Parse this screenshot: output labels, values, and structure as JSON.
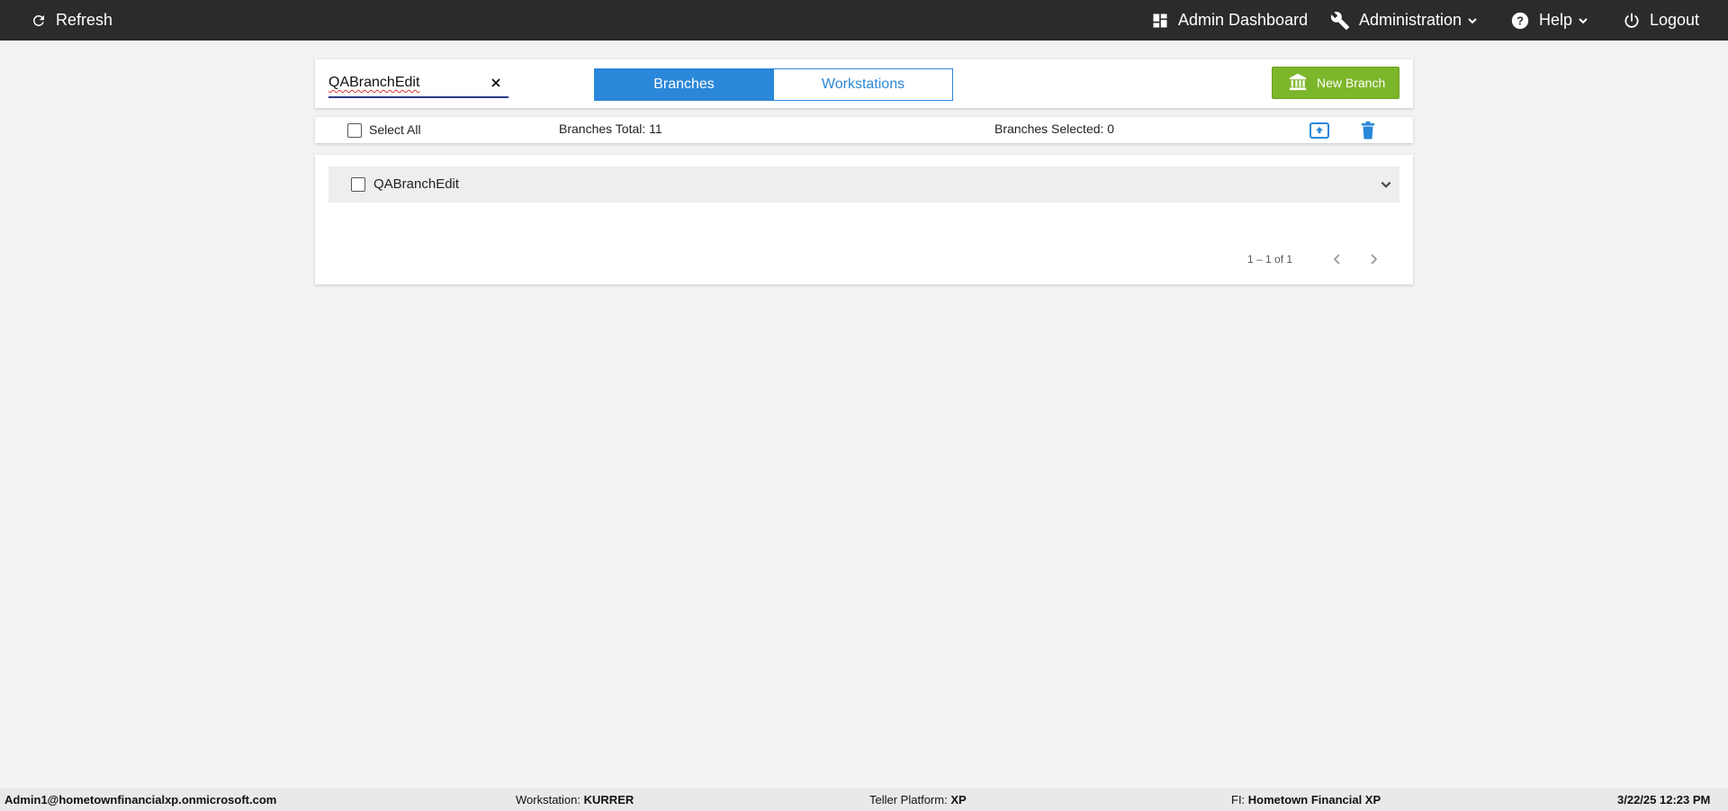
{
  "nav": {
    "refresh_label": "Refresh",
    "admin_dashboard_label": "Admin Dashboard",
    "administration_label": "Administration",
    "help_label": "Help",
    "logout_label": "Logout"
  },
  "toolbar": {
    "search_value": "QABranchEdit",
    "tabs": [
      {
        "label": "Branches",
        "active": true
      },
      {
        "label": "Workstations",
        "active": false
      }
    ],
    "new_branch_label": "New Branch"
  },
  "summary": {
    "select_all_label": "Select All",
    "branches_total": "Branches Total: 11",
    "branches_selected": "Branches Selected: 0"
  },
  "list": {
    "rows": [
      {
        "name": "QABranchEdit"
      }
    ],
    "pagination": "1 – 1 of 1"
  },
  "status": {
    "user": "Admin1@hometownfinancialxp.onmicrosoft.com",
    "workstation_label": "Workstation:",
    "workstation_value": "KURRER",
    "platform_label": "Teller Platform:",
    "platform_value": "XP",
    "fi_label": "FI:",
    "fi_value": "Hometown Financial XP",
    "datetime": "3/22/25 12:23 PM"
  },
  "colors": {
    "topbar": "#2b2b2b",
    "primary_blue": "#2b87d9",
    "new_branch_green": "#7cb62a",
    "background": "#f2f2f2"
  }
}
